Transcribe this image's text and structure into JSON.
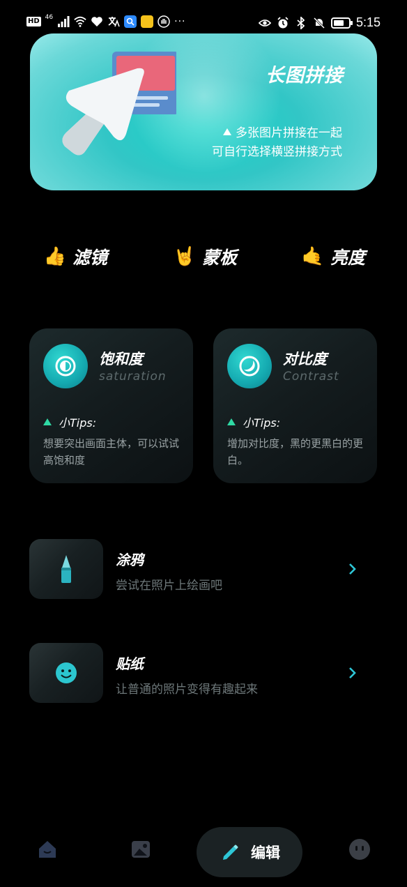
{
  "status_bar": {
    "hd": "HD",
    "network": "46",
    "dots": "···",
    "time": "5:15",
    "icons_left": [
      "hd-badge",
      "signal-icon",
      "wifi-icon",
      "heart-icon",
      "translate-icon",
      "search-app-icon",
      "app-badge-icon",
      "hand-icon",
      "more-dots"
    ],
    "icons_right": [
      "eye-icon",
      "alarm-icon",
      "bluetooth-icon",
      "mute-icon",
      "battery-icon"
    ]
  },
  "banner": {
    "title": "长图拼接",
    "line1": "多张图片拼接在一起",
    "line2": "可自行选择横竖拼接方式"
  },
  "tools": [
    {
      "label": "滤镜",
      "icon": "thumbs-up-hand-icon"
    },
    {
      "label": "蒙板",
      "icon": "rock-hand-icon"
    },
    {
      "label": "亮度",
      "icon": "call-me-hand-icon"
    }
  ],
  "cards": [
    {
      "title": "饱和度",
      "subtitle": "saturation",
      "tips": "小Tips:",
      "desc": "想要突出画面主体，可以试试高饱和度"
    },
    {
      "title": "对比度",
      "subtitle": "Contrast",
      "tips": "小Tips:",
      "desc": "增加对比度，黑的更黑白的更白。"
    }
  ],
  "list": [
    {
      "title": "涂鸦",
      "desc": "尝试在照片上绘画吧",
      "icon": "pen-icon"
    },
    {
      "title": "贴纸",
      "desc": "让普通的照片变得有趣起来",
      "icon": "smile-sticker-icon"
    }
  ],
  "nav": {
    "active_label": "编辑",
    "items": [
      "home-icon",
      "gallery-icon",
      "edit-icon",
      "profile-icon"
    ]
  },
  "colors": {
    "accent": "#2ec6d6",
    "tip_triangle": "#2fd9a4",
    "background": "#000000"
  }
}
